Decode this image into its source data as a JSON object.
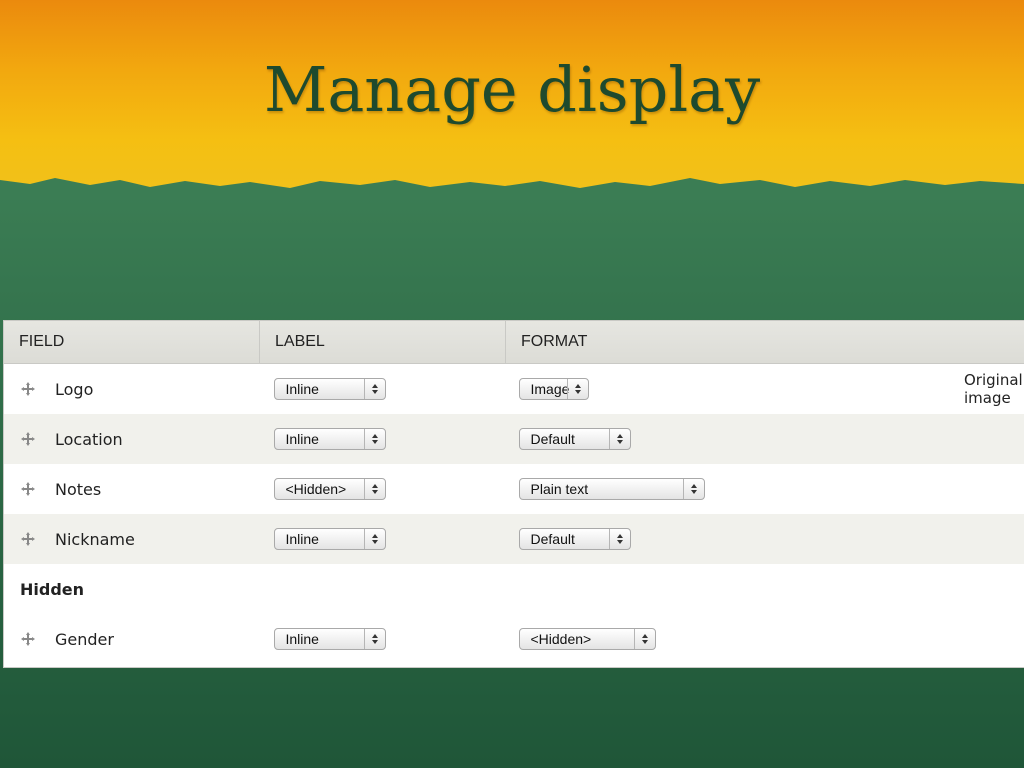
{
  "slide": {
    "title": "Manage display"
  },
  "colors": {
    "banner_top": "#eb8a0d",
    "banner_bottom": "#f1c11a",
    "green": "#3b7d54",
    "title_text": "#1e4a2e"
  },
  "table": {
    "headers": {
      "field": "FIELD",
      "label": "LABEL",
      "format": "FORMAT"
    },
    "rows": [
      {
        "field": "Logo",
        "label": "Inline",
        "format": "Image",
        "summary": "Original image"
      },
      {
        "field": "Location",
        "label": "Inline",
        "format": "Default"
      },
      {
        "field": "Notes",
        "label": "<Hidden>",
        "format": "Plain text"
      },
      {
        "field": "Nickname",
        "label": "Inline",
        "format": "Default"
      }
    ],
    "hidden_region": {
      "title": "Hidden",
      "rows": [
        {
          "field": "Gender",
          "label": "Inline",
          "format": "<Hidden>"
        }
      ]
    }
  },
  "icons": {
    "drag_handle": "drag-handle-icon",
    "select_arrow": "select-arrows-icon"
  }
}
